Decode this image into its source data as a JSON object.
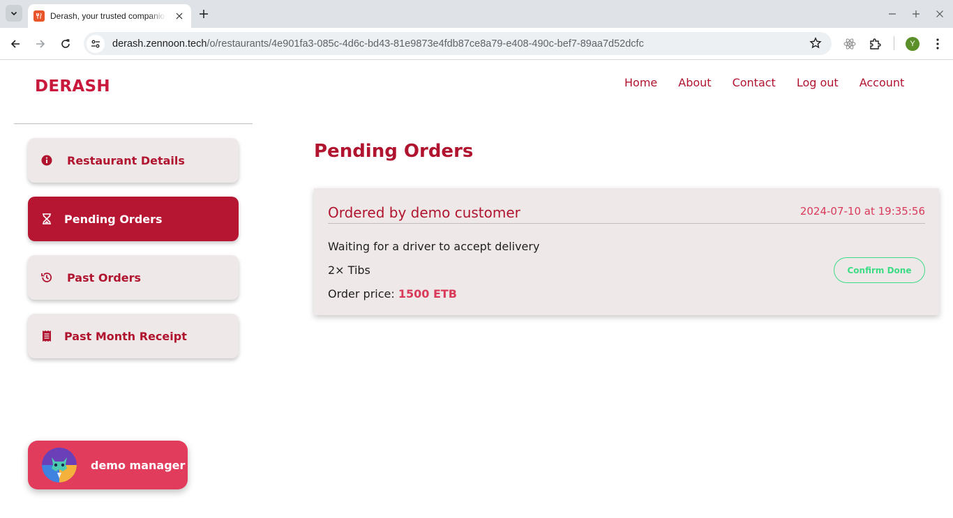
{
  "browser": {
    "tab_title": "Derash, your trusted companion",
    "url_host": "derash.zennoon.tech",
    "url_path": "/o/restaurants/4e901fa3-085c-4d6c-bd43-81e9873e4fdb87ce8a79-e408-490c-bef7-89aa7d52dcfc",
    "profile_initial": "Y"
  },
  "site": {
    "brand": "DERASH",
    "nav": [
      "Home",
      "About",
      "Contact",
      "Log out",
      "Account"
    ]
  },
  "sidebar": {
    "items": [
      {
        "label": "Restaurant Details",
        "icon": "info-circle-icon",
        "active": false
      },
      {
        "label": "Pending Orders",
        "icon": "hourglass-icon",
        "active": true
      },
      {
        "label": "Past Orders",
        "icon": "history-icon",
        "active": false
      },
      {
        "label": "Past Month Receipt",
        "icon": "receipt-icon",
        "active": false
      }
    ],
    "user": {
      "name": "demo manager",
      "avatar": "avatar-icon"
    }
  },
  "main": {
    "title": "Pending Orders",
    "orders": [
      {
        "ordered_by": "Ordered by demo customer",
        "timestamp": "2024-07-10 at 19:35:56",
        "status": "Waiting for a driver to accept delivery",
        "items": "2× Tibs",
        "price_label": "Order price: ",
        "price_value": "1500 ETB",
        "action": "Confirm Done"
      }
    ]
  },
  "colors": {
    "brand": "#c8193c",
    "accent_dark": "#b0142f",
    "active_bg": "#b71633",
    "card_bg": "#efe8e9",
    "confirm": "#3ddc84",
    "user_chip": "#e23c5c"
  }
}
